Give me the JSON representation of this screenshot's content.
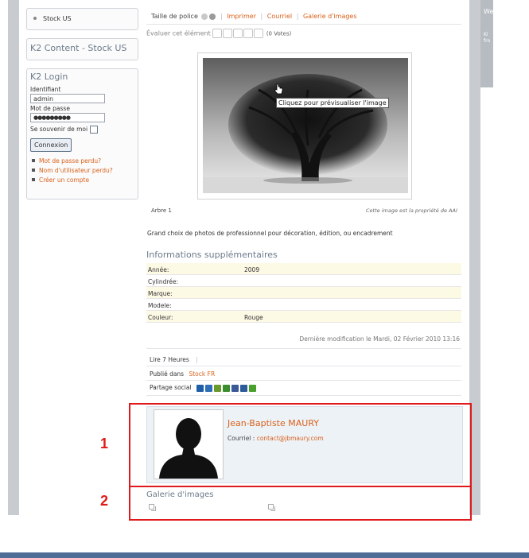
{
  "sidebar": {
    "stock_us_item": "Stock US",
    "k2_content_title": "K2 Content - Stock US",
    "login_title": "K2 Login",
    "username_label": "Identifiant",
    "username_value": "admin",
    "password_label": "Mot de passe",
    "password_value": "●●●●●●●●●",
    "remember_label": "Se souvenir de moi",
    "login_button": "Connexion",
    "links": [
      "Mot de passe perdu?",
      "Nom d'utilisateur perdu?",
      "Créer un compte"
    ]
  },
  "toolbar": {
    "font_size_label": "Taille de police",
    "print": "Imprimer",
    "email": "Courriel",
    "gallery": "Galerie d'images"
  },
  "rating": {
    "label": "Évaluer cet élément",
    "votes": "(0 Votes)",
    "stars_filled": 0,
    "stars_total": 5
  },
  "image": {
    "tooltip": "Cliquez pour prévisualiser l'image",
    "caption": "Arbre 1",
    "credit": "Cette image est la propriété de AAI"
  },
  "intro_text": "Grand choix de photos de professionnel pour décoration, édition, ou encadrement",
  "extra_fields": {
    "title": "Informations supplémentaires",
    "rows": [
      {
        "key": "Année:",
        "value": "2009"
      },
      {
        "key": "Cylindrée:",
        "value": ""
      },
      {
        "key": "Marque:",
        "value": ""
      },
      {
        "key": "Modele:",
        "value": ""
      },
      {
        "key": "Couleur:",
        "value": "Rouge"
      }
    ]
  },
  "modified": "Dernière modification le Mardi, 02 Février 2010 13:16",
  "hits": "Lire 7 Heures",
  "hits_sep": "|",
  "published_label": "Publié dans",
  "published_category": "Stock FR",
  "social_label": "Partage social",
  "social_colors": [
    "#1f5fa8",
    "#2f6fb7",
    "#6b9a2c",
    "#3b8e2e",
    "#3b5998",
    "#2d5c99",
    "#4aa02c"
  ],
  "author": {
    "name": "Jean-Baptiste MAURY",
    "email_label": "Courriel :",
    "email": "contact@jbmaury.com"
  },
  "gallery": {
    "title": "Galerie d'images"
  },
  "annotations": {
    "n1": "1",
    "n2": "2"
  },
  "rightcol": {
    "t1": "We",
    "t2": "Ki fro"
  },
  "colors": {
    "accent_link": "#d9611a",
    "title_gray": "#6b7b8c",
    "annotation_red": "#e01a1a",
    "bottom_bar": "#4f6d97"
  }
}
